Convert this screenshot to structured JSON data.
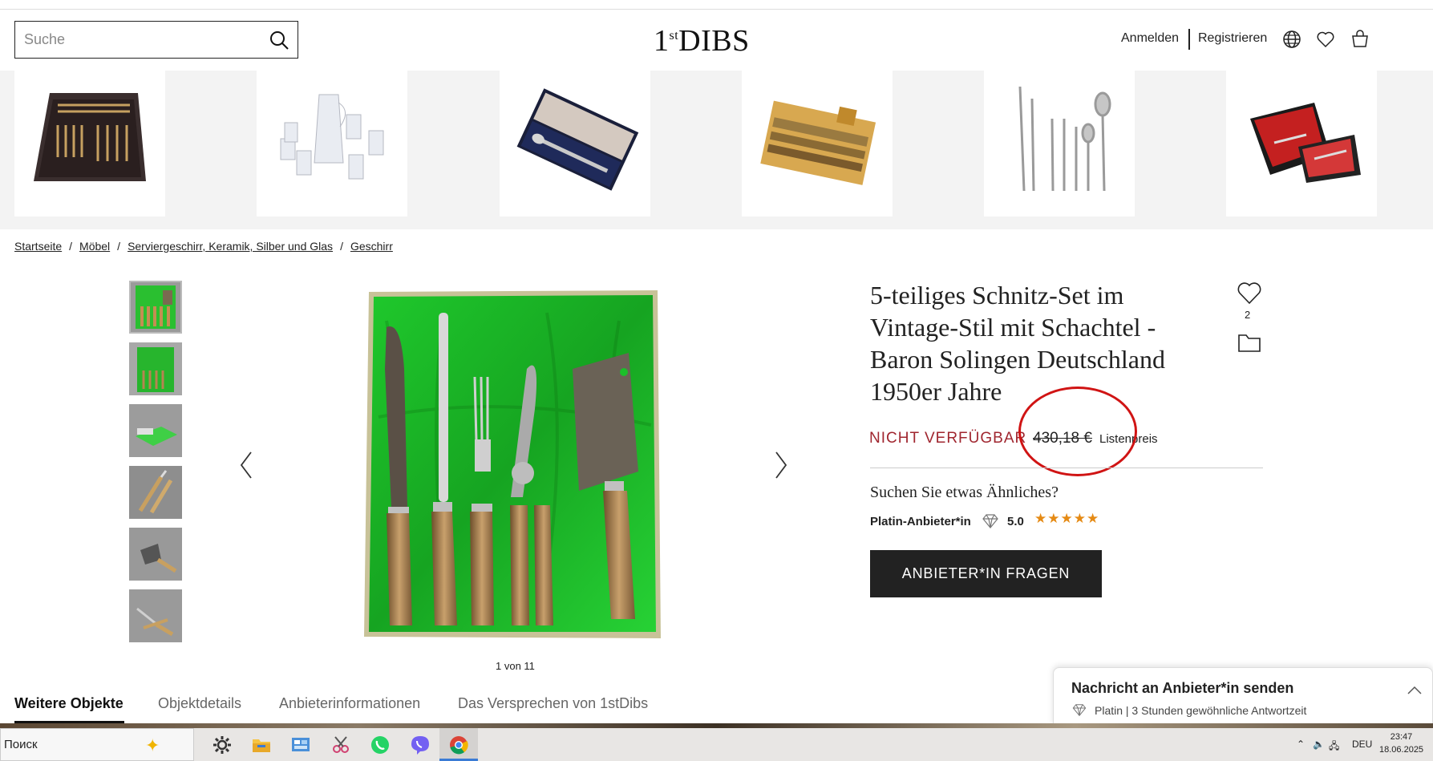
{
  "header": {
    "search_placeholder": "Suche",
    "logo": "DIBS",
    "logo_prefix": "1",
    "logo_sup": "st",
    "signin": "Anmelden",
    "register": "Registrieren"
  },
  "breadcrumb": [
    "Startseite",
    "Möbel",
    "Serviergeschirr, Keramik, Silber und Glas",
    "Geschirr"
  ],
  "breadcrumb_sep": "/",
  "gallery": {
    "counter": "1 von 11"
  },
  "product": {
    "title": "5-teiliges Schnitz-Set im Vintage-Stil mit Schachtel - Baron Solingen Deutschland 1950er Jahre",
    "favorites_count": "2",
    "status": "NICHT VERFÜGBAR",
    "old_price": "430,18 €",
    "price_label": "Listenpreis",
    "similar_prompt": "Suchen Sie etwas Ähnliches?",
    "seller_tier": "Platin-Anbieter*in",
    "rating": "5.0",
    "stars": "★★★★★",
    "cta": "ANBIETER*IN FRAGEN"
  },
  "tabs": [
    "Weitere Objekte",
    "Objektdetails",
    "Anbieterinformationen",
    "Das Versprechen von 1stDibs"
  ],
  "chat": {
    "title": "Nachricht an Anbieter*in senden",
    "subtitle": "Platin | 3 Stunden gewöhnliche Antwortzeit"
  },
  "taskbar": {
    "search_label": "Поиск",
    "language": "DEU",
    "time": "23:47",
    "date": "18.06.2025"
  },
  "colors": {
    "status_red": "#a0262f",
    "annotation_red": "#d01414",
    "cta_bg": "#222222",
    "star": "#e58a14",
    "satin_green": "#1bbf2a"
  }
}
